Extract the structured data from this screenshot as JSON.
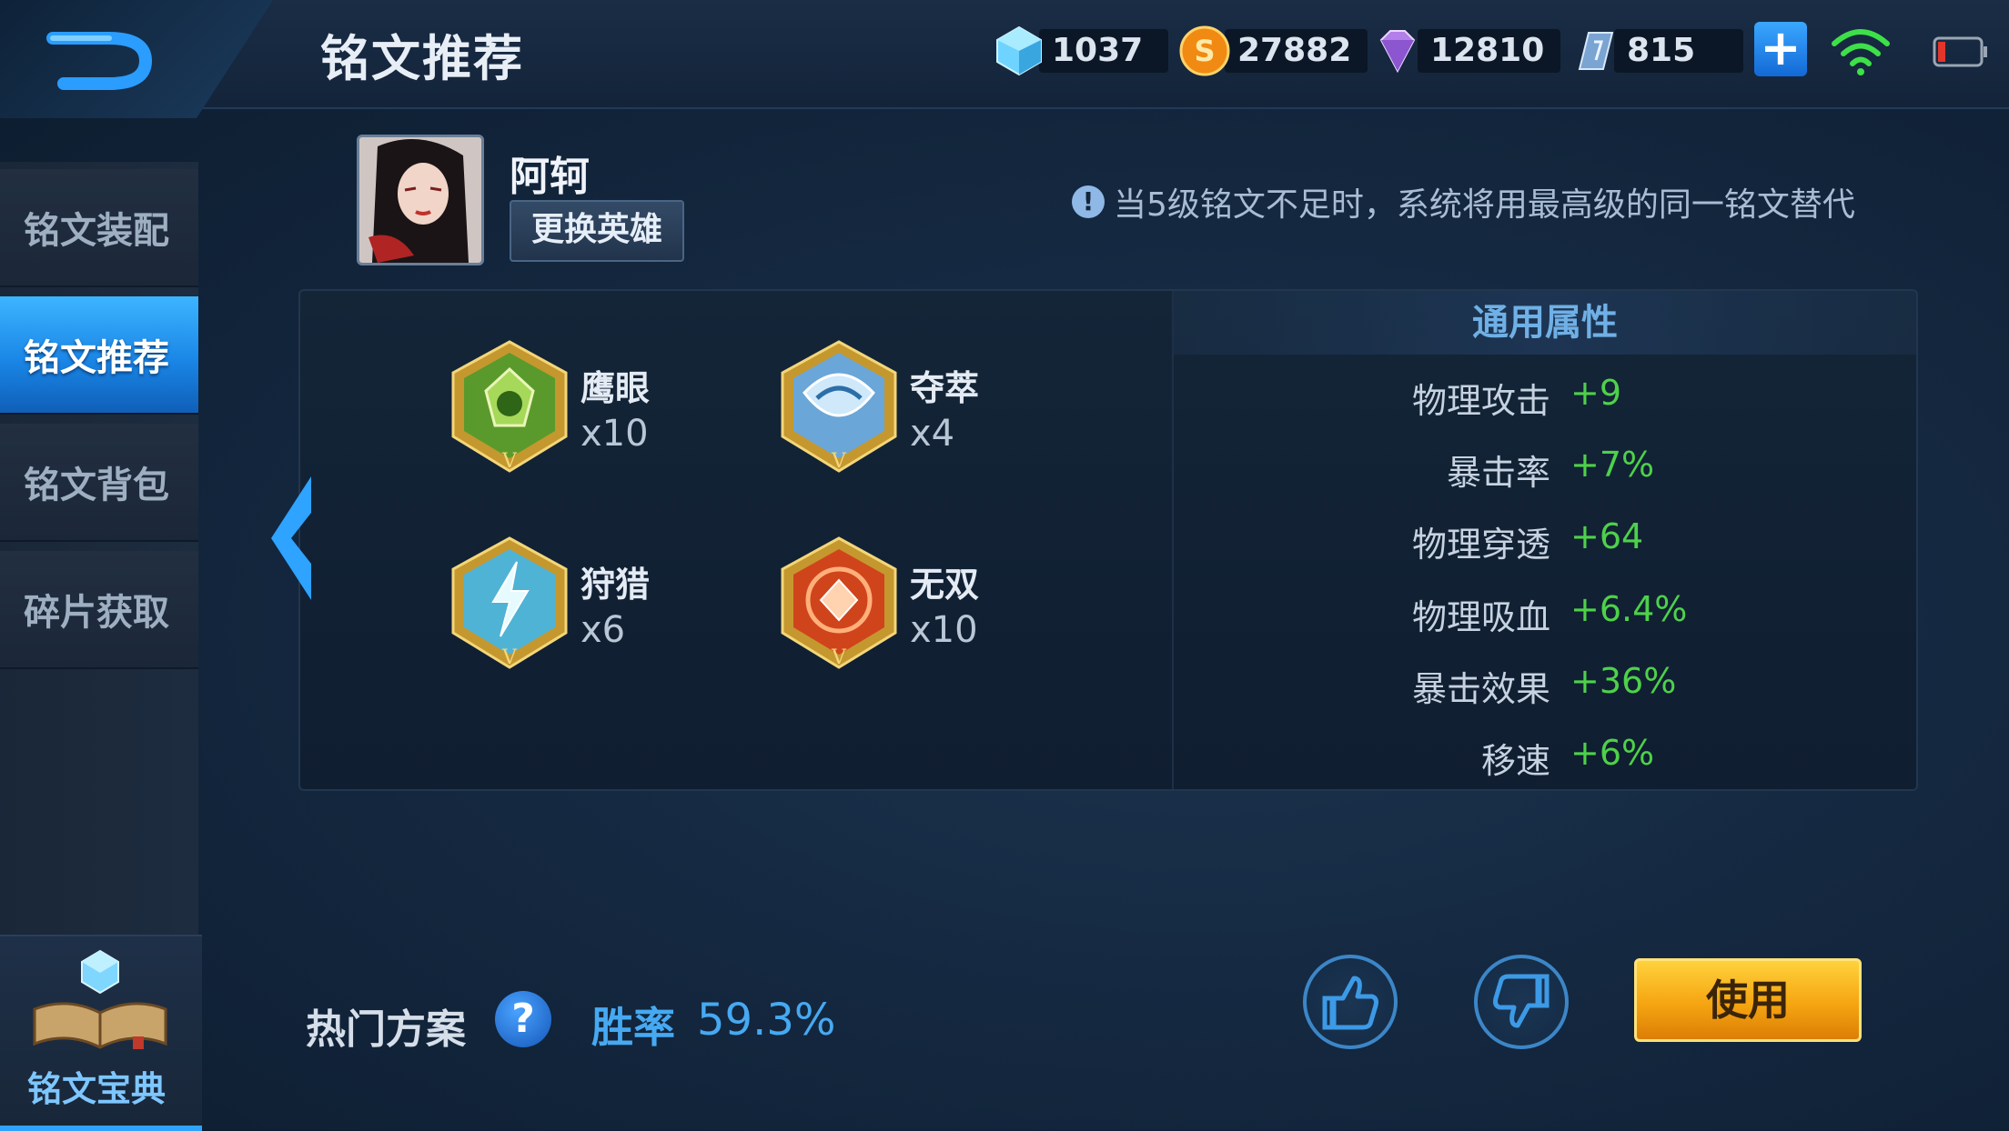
{
  "header": {
    "title": "铭文推荐",
    "back_icon": "back-arrow-icon",
    "currencies": [
      {
        "icon": "diamond-crystal-icon",
        "amount": "1037"
      },
      {
        "icon": "gold-coin-icon",
        "amount": "27882"
      },
      {
        "icon": "gem-icon",
        "amount": "12810"
      },
      {
        "icon": "voucher-icon",
        "amount": "815"
      }
    ],
    "add_icon": "plus-icon",
    "wifi_icon": "wifi-icon",
    "battery_icon": "battery-icon"
  },
  "sidebar": {
    "items": [
      {
        "label": "铭文装配"
      },
      {
        "label": "铭文推荐"
      },
      {
        "label": "铭文背包"
      },
      {
        "label": "碎片获取"
      }
    ],
    "active_index": 1,
    "codex_label": "铭文宝典"
  },
  "hero": {
    "name": "阿轲",
    "change_label": "更换英雄",
    "notice": "当5级铭文不足时，系统将用最高级的同一铭文替代"
  },
  "runes": [
    {
      "name": "鹰眼",
      "count": "x10",
      "color": "#5a9a2c"
    },
    {
      "name": "夺萃",
      "count": "x4",
      "color": "#6aa6d8"
    },
    {
      "name": "狩猎",
      "count": "x6",
      "color": "#4fb3d6"
    },
    {
      "name": "无双",
      "count": "x10",
      "color": "#d0441c"
    }
  ],
  "attributes": {
    "header": "通用属性",
    "rows": [
      {
        "label": "物理攻击",
        "value": "+9"
      },
      {
        "label": "暴击率",
        "value": "+7%"
      },
      {
        "label": "物理穿透",
        "value": "+64"
      },
      {
        "label": "物理吸血",
        "value": "+6.4%"
      },
      {
        "label": "暴击效果",
        "value": "+36%"
      },
      {
        "label": "移速",
        "value": "+6%"
      }
    ]
  },
  "footer": {
    "hot_label": "热门方案",
    "help_symbol": "?",
    "winrate_label": "胜率",
    "winrate_value": "59.3%",
    "use_label": "使用"
  },
  "colors": {
    "accent_blue": "#2ea3ff",
    "value_green": "#4ed14a",
    "use_button": "#f5a511"
  }
}
